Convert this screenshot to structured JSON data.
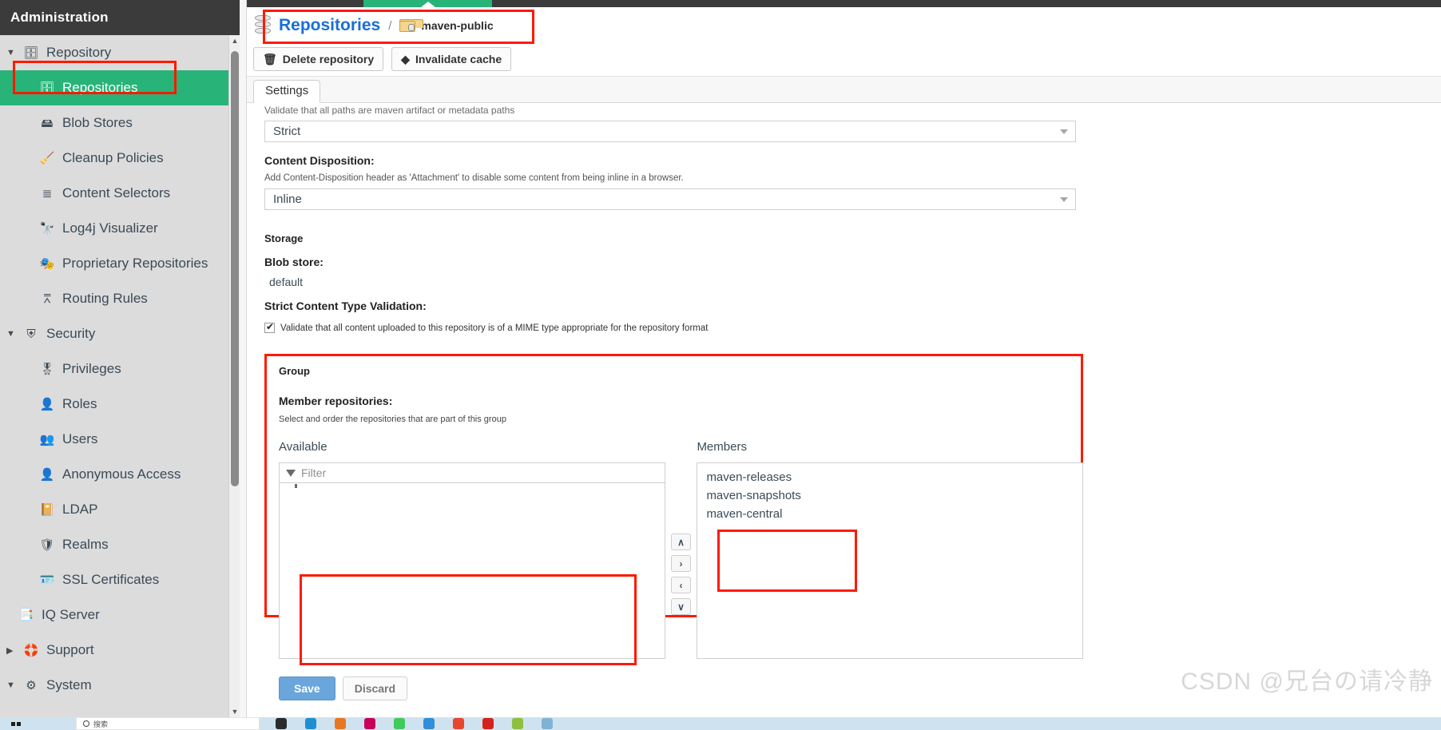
{
  "sidebar": {
    "header": "Administration",
    "items": [
      {
        "label": "Repository",
        "icon": "database-icon",
        "level": "group",
        "caret": "▼",
        "glyph": "🗄",
        "selected": false
      },
      {
        "label": "Repositories",
        "icon": "database-icon",
        "level": "child",
        "caret": "",
        "glyph": "🗄",
        "selected": true
      },
      {
        "label": "Blob Stores",
        "icon": "server-icon",
        "level": "child",
        "caret": "",
        "glyph": "🖴",
        "selected": false
      },
      {
        "label": "Cleanup Policies",
        "icon": "broom-icon",
        "level": "child",
        "caret": "",
        "glyph": "🧹",
        "selected": false
      },
      {
        "label": "Content Selectors",
        "icon": "layers-icon",
        "level": "child",
        "caret": "",
        "glyph": "≣",
        "selected": false
      },
      {
        "label": "Log4j Visualizer",
        "icon": "binoculars-icon",
        "level": "child",
        "caret": "",
        "glyph": "🔭",
        "selected": false
      },
      {
        "label": "Proprietary Repositories",
        "icon": "masks-icon",
        "level": "child",
        "caret": "",
        "glyph": "🎭",
        "selected": false
      },
      {
        "label": "Routing Rules",
        "icon": "signpost-icon",
        "level": "child",
        "caret": "",
        "glyph": "⩞",
        "selected": false
      },
      {
        "label": "Security",
        "icon": "shield-icon",
        "level": "group",
        "caret": "▼",
        "glyph": "⛨",
        "selected": false
      },
      {
        "label": "Privileges",
        "icon": "medal-icon",
        "level": "child",
        "caret": "",
        "glyph": "🎖",
        "selected": false
      },
      {
        "label": "Roles",
        "icon": "person-tie-icon",
        "level": "child",
        "caret": "",
        "glyph": "👤",
        "selected": false
      },
      {
        "label": "Users",
        "icon": "users-icon",
        "level": "child",
        "caret": "",
        "glyph": "👥",
        "selected": false
      },
      {
        "label": "Anonymous Access",
        "icon": "anon-user-icon",
        "level": "child",
        "caret": "",
        "glyph": "👤",
        "selected": false
      },
      {
        "label": "LDAP",
        "icon": "address-book-icon",
        "level": "child",
        "caret": "",
        "glyph": "📔",
        "selected": false
      },
      {
        "label": "Realms",
        "icon": "shield-gold-icon",
        "level": "child",
        "caret": "",
        "glyph": "🛡",
        "selected": false
      },
      {
        "label": "SSL Certificates",
        "icon": "certificate-icon",
        "level": "child",
        "caret": "",
        "glyph": "🪪",
        "selected": false
      },
      {
        "label": "IQ Server",
        "icon": "iq-server-icon",
        "level": "leaf-top",
        "caret": "",
        "glyph": "📑",
        "selected": false
      },
      {
        "label": "Support",
        "icon": "lifebuoy-icon",
        "level": "group",
        "caret": "▶",
        "glyph": "🛟",
        "selected": false
      },
      {
        "label": "System",
        "icon": "gear-icon",
        "level": "group",
        "caret": "▼",
        "glyph": "⚙",
        "selected": false
      }
    ]
  },
  "breadcrumb": {
    "root": "Repositories",
    "separator": "/",
    "current": "maven-public"
  },
  "actions": {
    "delete_repository": "Delete repository",
    "delete_icon": "🗑",
    "invalidate_cache": "Invalidate cache",
    "invalidate_icon": "◆"
  },
  "tabs": [
    {
      "label": "Settings",
      "active": true
    }
  ],
  "form": {
    "layout_policy_help": "Validate that all paths are maven artifact or metadata paths",
    "layout_policy_value": "Strict",
    "content_disposition_label": "Content Disposition:",
    "content_disposition_help": "Add Content-Disposition header as 'Attachment' to disable some content from being inline in a browser.",
    "content_disposition_value": "Inline",
    "storage_title": "Storage",
    "blob_store_label": "Blob store:",
    "blob_store_value": "default",
    "strict_validation_label": "Strict Content Type Validation:",
    "strict_validation_checkbox_text": "Validate that all content uploaded to this repository is of a MIME type appropriate for the repository format",
    "strict_validation_checked": true
  },
  "group": {
    "title": "Group",
    "member_repositories_label": "Member repositories:",
    "member_repositories_help": "Select and order the repositories that are part of this group",
    "available_caption": "Available",
    "members_caption": "Members",
    "filter_placeholder": "Filter",
    "filter_value": "",
    "available_items": [],
    "member_items": [
      "maven-releases",
      "maven-snapshots",
      "maven-central"
    ],
    "transfer_buttons": [
      {
        "name": "move-up-button",
        "glyph": "∧"
      },
      {
        "name": "add-button",
        "glyph": "›"
      },
      {
        "name": "remove-button",
        "glyph": "‹"
      },
      {
        "name": "move-down-button",
        "glyph": "∨"
      }
    ]
  },
  "footer": {
    "save": "Save",
    "discard": "Discard"
  },
  "watermark": "CSDN @兄台の请冷静",
  "taskbar": {
    "search_placeholder": "搜索",
    "icons": [
      {
        "name": "task-view-icon",
        "color": "#2b2b2b"
      },
      {
        "name": "edge-icon",
        "color": "#1e90d2"
      },
      {
        "name": "office-icon",
        "color": "#e87722"
      },
      {
        "name": "media-icon",
        "color": "#c8005a"
      },
      {
        "name": "wechat-icon",
        "color": "#3ecb5a"
      },
      {
        "name": "qq-browser-icon",
        "color": "#2f8fd8"
      },
      {
        "name": "music-icon",
        "color": "#e8452f"
      },
      {
        "name": "youdao-icon",
        "color": "#d4231f"
      },
      {
        "name": "explorer-icon",
        "color": "#8fbf3f"
      },
      {
        "name": "notes-icon",
        "color": "#7fb3d5"
      }
    ]
  },
  "colors": {
    "accent_green": "#28b378",
    "link_blue": "#1a6fd4",
    "highlight_red": "#ff1a00",
    "header_dark": "#3b3b3b",
    "save_blue": "#6aa5db"
  }
}
